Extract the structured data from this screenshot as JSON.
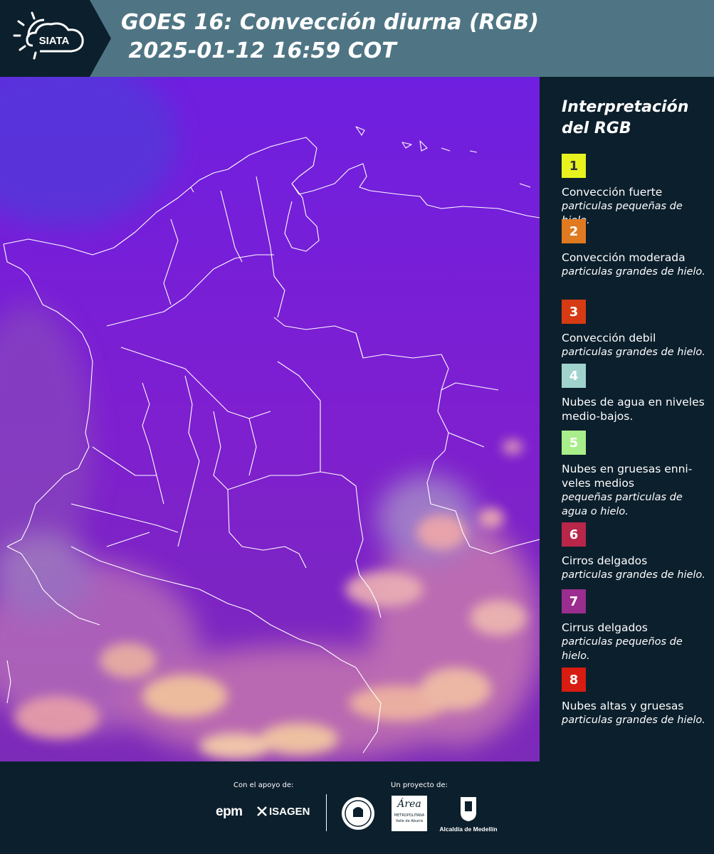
{
  "header": {
    "logo_text": "SIATA",
    "title_line1": "GOES 16: Convección diurna (RGB)",
    "title_line2": " 2025-01-12 16:59 COT"
  },
  "legend": {
    "title": "Interpretación del RGB",
    "items": [
      {
        "number": "1",
        "color": "#e8f21e",
        "text_color": "#333333",
        "label": "Convección fuerte",
        "desc": "particulas pequeñas de hielo."
      },
      {
        "number": "2",
        "color": "#e07a20",
        "text_color": "#ffffff",
        "label": "Convección moderada",
        "desc": "particulas grandes de hielo."
      },
      {
        "number": "3",
        "color": "#d63b14",
        "text_color": "#ffffff",
        "label": "Convección debil",
        "desc": "particulas grandes de hielo."
      },
      {
        "number": "4",
        "color": "#9fd3cc",
        "text_color": "#ffffff",
        "label": "Nubes de agua en niveles medio-bajos.",
        "desc": ""
      },
      {
        "number": "5",
        "color": "#a8ee8a",
        "text_color": "#ffffff",
        "label": "Nubes en gruesas enni-veles medios",
        "desc": "pequeñas particulas de agua o hielo."
      },
      {
        "number": "6",
        "color": "#b8264a",
        "text_color": "#ffffff",
        "label": "Cirros delgados",
        "desc": "particulas grandes de hielo."
      },
      {
        "number": "7",
        "color": "#9a2d8e",
        "text_color": "#ffffff",
        "label": "Cirrus delgados",
        "desc": "particulas pequeños de hielo."
      },
      {
        "number": "8",
        "color": "#d81c12",
        "text_color": "#ffffff",
        "label": "Nubes altas y gruesas",
        "desc": "particulas grandes de hielo."
      }
    ]
  },
  "footer": {
    "support_label": "Con el apoyo de:",
    "project_label": "Un proyecto de:",
    "sponsor_epm": "epm",
    "sponsor_isagen": "ISAGEN",
    "amva_name": "Área",
    "amva_sub1": "METROPOLITANA",
    "amva_sub2": "Valle de Aburrá",
    "alcaldia": "Alcaldía de Medellín"
  }
}
